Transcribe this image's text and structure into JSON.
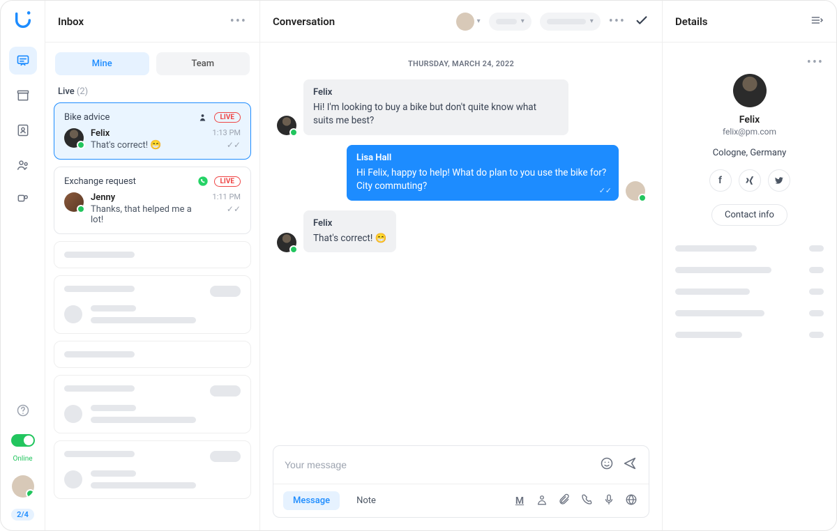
{
  "rail": {
    "online_label": "Online",
    "badge": "2/4"
  },
  "inbox": {
    "title": "Inbox",
    "tabs": {
      "mine": "Mine",
      "team": "Team"
    },
    "section_label": "Live",
    "section_count": "(2)",
    "cards": [
      {
        "subject": "Bike advice",
        "badge": "LIVE",
        "name": "Felix",
        "preview": "That's correct! 😁",
        "time": "1:13 PM"
      },
      {
        "subject": "Exchange request",
        "badge": "LIVE",
        "name": "Jenny",
        "preview": "Thanks, that helped me a lot!",
        "time": "1:11 PM"
      }
    ]
  },
  "conversation": {
    "title": "Conversation",
    "date": "THURSDAY, MARCH 24, 2022",
    "messages": [
      {
        "sender": "Felix",
        "text": "Hi! I'm looking to buy a bike but don't quite know what suits me best?"
      },
      {
        "sender": "Lisa Hall",
        "text": "Hi Felix, happy to help! What do plan to you use the bike for? City commuting?"
      },
      {
        "sender": "Felix",
        "text": "That's correct! 😁"
      }
    ],
    "composer": {
      "placeholder": "Your message",
      "tabs": {
        "message": "Message",
        "note": "Note"
      }
    }
  },
  "details": {
    "title": "Details",
    "name": "Felix",
    "email": "felix@pm.com",
    "location": "Cologne, Germany",
    "contact_button": "Contact info"
  }
}
